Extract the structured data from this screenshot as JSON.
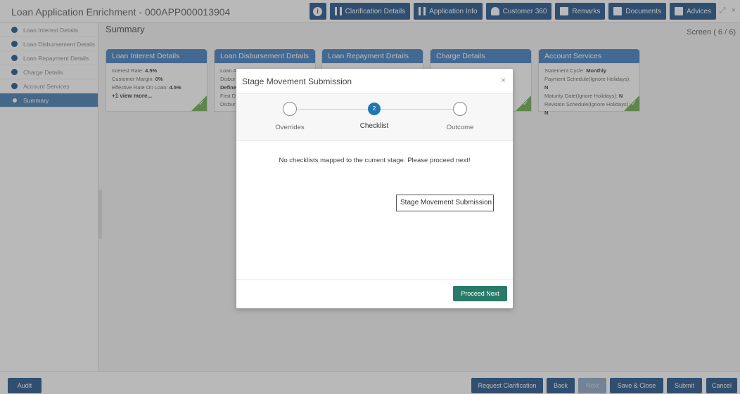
{
  "app": {
    "title": "Loan Application Enrichment - 000APP000013904",
    "screen": "Screen ( 6 / 6)",
    "page_title": "Summary"
  },
  "toolbar": [
    {
      "label": "",
      "icon": "info-icon"
    },
    {
      "label": "Clarification Details",
      "icon": "bars-icon"
    },
    {
      "label": "Application Info",
      "icon": "bars-icon"
    },
    {
      "label": "Customer 360",
      "icon": "user-icon"
    },
    {
      "label": "Remarks",
      "icon": "chat-icon"
    },
    {
      "label": "Documents",
      "icon": "document-icon"
    },
    {
      "label": "Advices",
      "icon": "clipboard-icon"
    }
  ],
  "window_controls": {
    "maximize": "⤢",
    "close": "×"
  },
  "sidebar": {
    "items": [
      {
        "label": "Loan Interest Details"
      },
      {
        "label": "Loan Disbursement Details"
      },
      {
        "label": "Loan Repayment Details"
      },
      {
        "label": "Charge Details"
      },
      {
        "label": "Account Services"
      },
      {
        "label": "Summary",
        "active": true
      }
    ]
  },
  "cards": [
    {
      "title": "Loan Interest Details",
      "lines": [
        {
          "label": "Interest Rate:",
          "value": "4.5%"
        },
        {
          "label": "Customer Margin:",
          "value": "0%"
        },
        {
          "label": "Effective Rate On Loan:",
          "value": "4.5%"
        }
      ],
      "more": "+1 view more..."
    },
    {
      "title": "Loan Disbursement Details",
      "lines": [
        {
          "label": "Loan A",
          "value": ""
        },
        {
          "label": "Disbur",
          "value": ""
        },
        {
          "label": "",
          "value": "Define"
        },
        {
          "label": "First D",
          "value": ""
        },
        {
          "label": "Disbur",
          "value": ""
        }
      ],
      "more": ""
    },
    {
      "title": "Loan Repayment Details",
      "lines": [],
      "more": ""
    },
    {
      "title": "Charge Details",
      "lines": [],
      "more": ""
    },
    {
      "title": "Account Services",
      "lines": [
        {
          "label": "Statement Cycle:",
          "value": "Monthly"
        },
        {
          "label": "Payment Schedule(Ignore Holidays):",
          "value": "N"
        },
        {
          "label": "Maturity Date(Ignore Holidays):",
          "value": "N"
        },
        {
          "label": "Revision Schedule(Ignore Holidays):",
          "value": "N"
        }
      ],
      "more": ""
    }
  ],
  "modal": {
    "title": "Stage Movement Submission",
    "close": "×",
    "steps": [
      {
        "label": "Overrides",
        "number": ""
      },
      {
        "label": "Checklist",
        "number": "2",
        "current": true
      },
      {
        "label": "Outcome",
        "number": ""
      }
    ],
    "message": "No checklists mapped to the current stage. Please proceed next!",
    "tooltip": "Stage Movement Submission",
    "proceed_label": "Proceed Next"
  },
  "footer": {
    "audit": "Audit",
    "request_clarification": "Request Clarification",
    "back": "Back",
    "next": "Next",
    "save_close": "Save & Close",
    "submit": "Submit",
    "cancel": "Cancel"
  },
  "colors": {
    "primary": "#1b4f86",
    "card_header": "#3b7abf",
    "step_current": "#1f78b4",
    "proceed": "#2a7a6a",
    "check": "#6aab46"
  }
}
